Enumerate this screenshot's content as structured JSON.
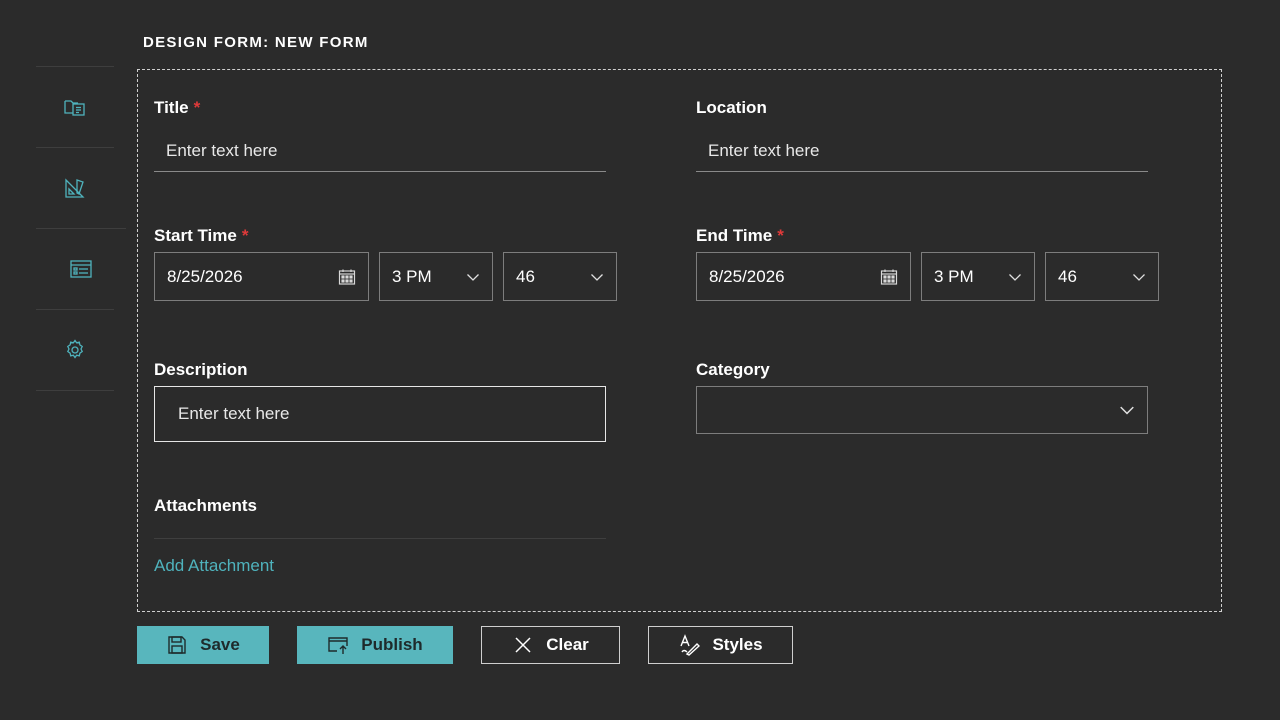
{
  "header": {
    "title": "DESIGN FORM: NEW FORM"
  },
  "sidebar": {
    "items": [
      {
        "icon": "folder-form-icon"
      },
      {
        "icon": "design-tools-icon"
      },
      {
        "icon": "form-list-icon"
      },
      {
        "icon": "gear-icon"
      }
    ]
  },
  "form": {
    "title": {
      "label": "Title",
      "required_mark": "*",
      "placeholder": "Enter text here",
      "value": ""
    },
    "location": {
      "label": "Location",
      "placeholder": "Enter text here",
      "value": ""
    },
    "start_time": {
      "label": "Start Time",
      "required_mark": "*",
      "date": "8/25/2026",
      "hour": "3 PM",
      "minute": "46"
    },
    "end_time": {
      "label": "End Time",
      "required_mark": "*",
      "date": "8/25/2026",
      "hour": "3 PM",
      "minute": "46"
    },
    "description": {
      "label": "Description",
      "placeholder": "Enter text here",
      "value": ""
    },
    "category": {
      "label": "Category",
      "value": ""
    },
    "attachments": {
      "label": "Attachments",
      "add_link": "Add Attachment"
    }
  },
  "actions": {
    "save": "Save",
    "publish": "Publish",
    "clear": "Clear",
    "styles": "Styles"
  },
  "colors": {
    "accent": "#58b6bd",
    "link": "#4fb3bd",
    "required": "#e03a3a",
    "background": "#2b2b2b"
  }
}
